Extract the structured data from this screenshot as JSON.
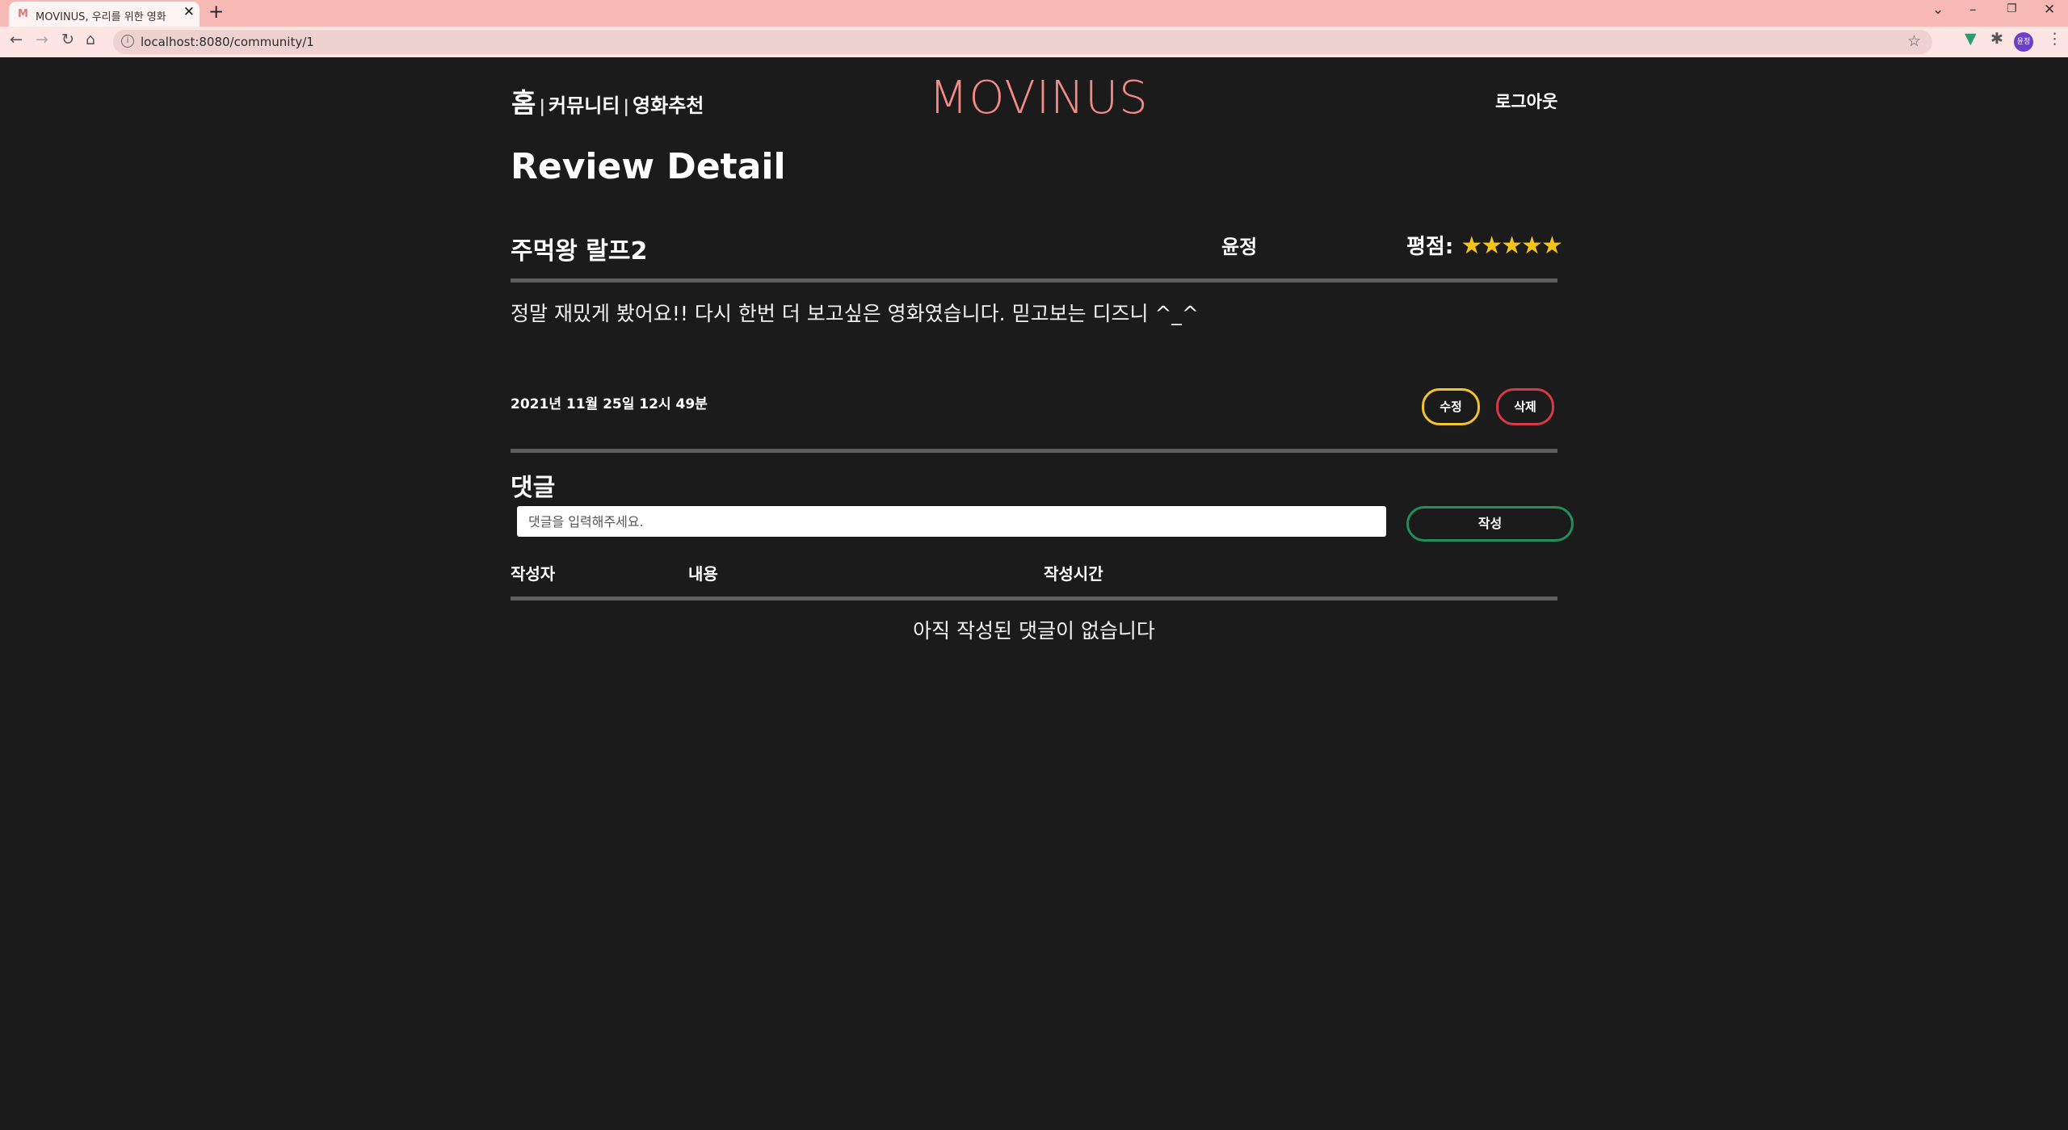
{
  "browser": {
    "tab_title": "MOVINUS, 우리를 위한 영화",
    "tab_favicon": "M",
    "url": "localhost:8080/community/1",
    "avatar_text": "윤정"
  },
  "nav": {
    "home": "홈",
    "separator": "|",
    "community": "커뮤니티",
    "recommend": "영화추천",
    "logout": "로그아웃"
  },
  "logo": "MOVINUS",
  "page_title": "Review Detail",
  "review": {
    "movie_title": "주먹왕 랄프2",
    "author": "윤정",
    "rating_label": "평점:",
    "stars": "★★★★★",
    "content": "정말 재밌게 봤어요!! 다시 한번 더 보고싶은 영화였습니다. 믿고보는 디즈니 ^_^",
    "date": "2021년 11월 25일 12시 49분",
    "edit_label": "수정",
    "delete_label": "삭제"
  },
  "comments": {
    "title": "댓글",
    "placeholder": "댓글을 입력해주세요.",
    "submit_label": "작성",
    "col_author": "작성자",
    "col_content": "내용",
    "col_time": "작성시간",
    "empty_message": "아직 작성된 댓글이 없습니다"
  },
  "colors": {
    "logo": "#f28a85",
    "stars": "#f6c419",
    "edit_border": "#f2c230",
    "delete_border": "#d8394a",
    "submit_border": "#1f8f5b",
    "background": "#1b1b1b"
  }
}
